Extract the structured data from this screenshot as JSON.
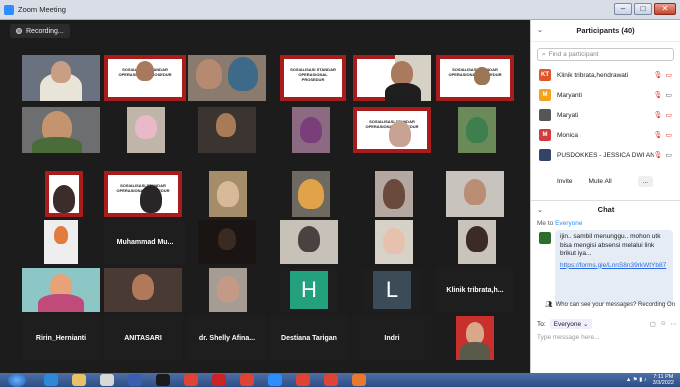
{
  "window": {
    "title": "Zoom Meeting",
    "controls": [
      "–",
      "□",
      "✕"
    ]
  },
  "meeting": {
    "recording_label": "Recording...",
    "grid_names": {
      "r4c2": "Muhammad Mu...",
      "r5c6": "H",
      "r5c7": "L",
      "r5c8": "Klinik tribrata,h...",
      "r6c1": "Ririn_Hernianti",
      "r6c2": "ANITASARI",
      "r6c3": "dr. Shelly Afina...",
      "r6c4": "Destiana Tarigan",
      "r6c5": "Indri"
    },
    "banner_text": "SOSIALISASI STANDAR OPERASIONAL PROSEDUR"
  },
  "participants": {
    "title": "Participants (40)",
    "search_placeholder": "Find a participant",
    "list": [
      {
        "initials": "KT",
        "name": "Klinik tribrata,hendrawati",
        "color": "#e0562a"
      },
      {
        "initials": "M",
        "name": "Maryanti",
        "color": "#f4a11b"
      },
      {
        "initials": "",
        "name": "Maryati",
        "color": "#555555"
      },
      {
        "initials": "M",
        "name": "Monica",
        "color": "#d33c3c"
      },
      {
        "initials": "",
        "name": "PUSDOKKES - JESSICA DWI AN...",
        "color": "#334466"
      }
    ],
    "invite_label": "Invite",
    "mute_all_label": "Mute All",
    "more_label": "..."
  },
  "chat": {
    "title": "Chat",
    "from": "Me",
    "to": "Everyone",
    "message": "ijin.. sambil menunggu.. mohon utk bisa mengisi absensi melalui link brikut iya...",
    "link": "https://forms.gle/LnnS8n39rkWtYb87",
    "visibility_note": "Who can see your messages? Recording On",
    "to_label": "To:",
    "to_value": "Everyone",
    "input_placeholder": "Type message here..."
  },
  "taskbar": {
    "time": "7:11 PM",
    "date": "3/3/2022"
  }
}
